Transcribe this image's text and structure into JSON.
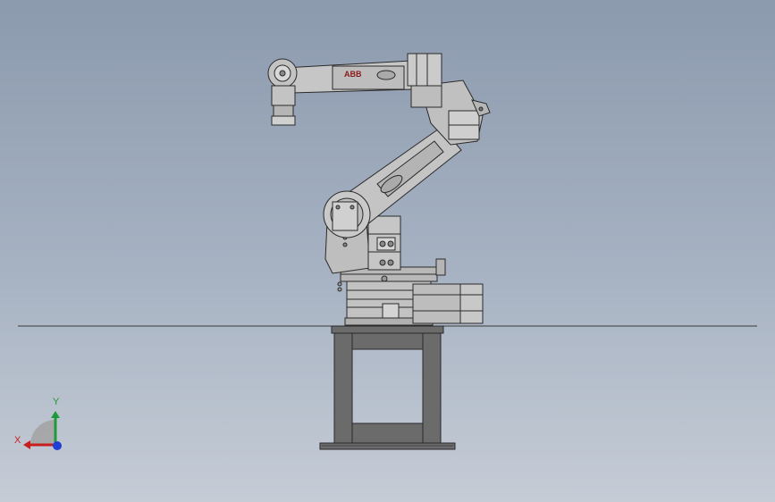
{
  "viewport": {
    "background_top": "#8c9aae",
    "background_bottom": "#c6ccd6"
  },
  "robot": {
    "logo_text": "ABB",
    "body_color": "#bfbfbf",
    "line_color": "#2a2a2a"
  },
  "stand": {
    "color": "#6b6b6b"
  },
  "triad": {
    "x_label": "X",
    "y_label": "Y",
    "x_color": "#c81e1e",
    "y_color": "#1e9a3a",
    "z_color": "#1f3fd6"
  }
}
